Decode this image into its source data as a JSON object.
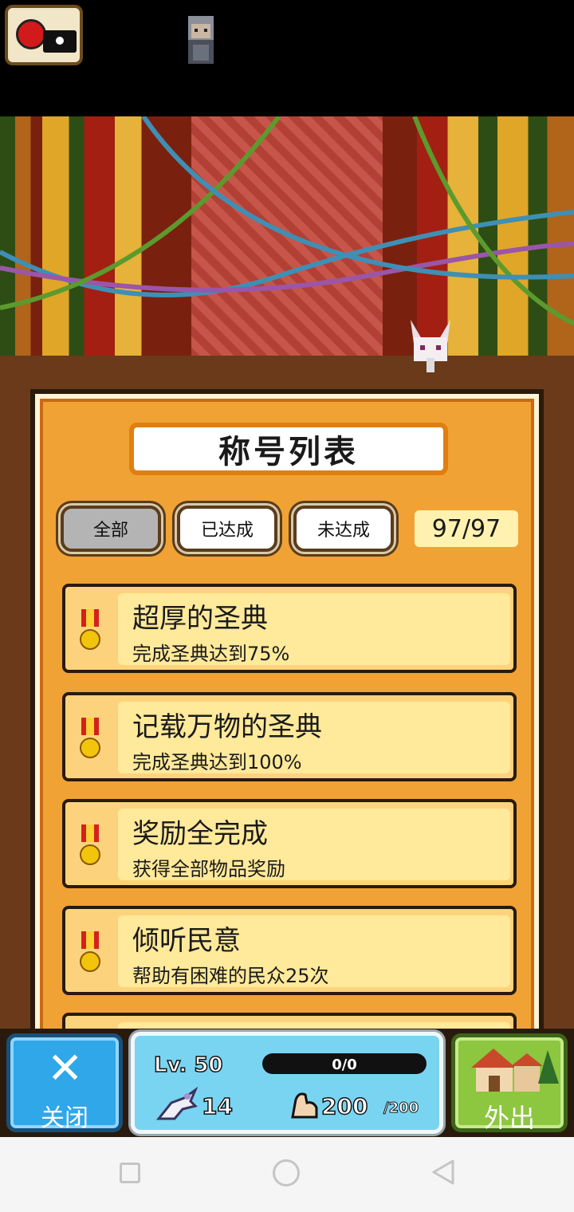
{
  "title": "称号列表",
  "filters": [
    {
      "label": "全部",
      "active": true
    },
    {
      "label": "已达成",
      "active": false
    },
    {
      "label": "未达成",
      "active": false
    }
  ],
  "counter": "97/97",
  "titles": [
    {
      "name": "超厚的圣典",
      "desc": "完成圣典达到75%"
    },
    {
      "name": "记载万物的圣典",
      "desc": "完成圣典达到100%"
    },
    {
      "name": "奖励全完成",
      "desc": "获得全部物品奖励"
    },
    {
      "name": "倾听民意",
      "desc": "帮助有困难的民众25次"
    },
    {
      "name": "",
      "desc": ""
    }
  ],
  "hud": {
    "close_label": "关闭",
    "level": "Lv. 50",
    "exp": "0/0",
    "paw_count": "14",
    "stamina": "200",
    "stamina_max": "/200",
    "out_label": "外出"
  },
  "colors": {
    "panel": "#f1a234",
    "card": "#fcd37c",
    "close": "#2fa7e9",
    "out": "#8dc63f"
  }
}
